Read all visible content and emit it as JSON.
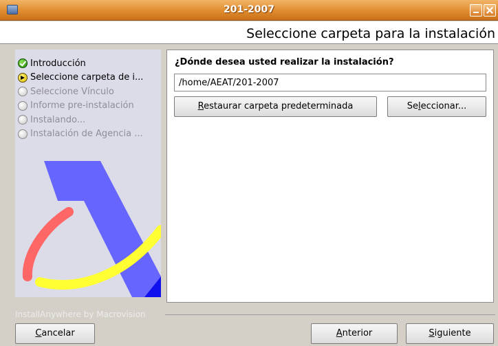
{
  "window": {
    "title": "201-2007"
  },
  "header": {
    "heading": "Seleccione carpeta para la instalación"
  },
  "steps": [
    {
      "label": "Introducción",
      "state": "done"
    },
    {
      "label": "Seleccione carpeta de i...",
      "state": "current"
    },
    {
      "label": "Seleccione  Vínculo",
      "state": "pending"
    },
    {
      "label": "Informe pre-instalación",
      "state": "pending"
    },
    {
      "label": "Instalando...",
      "state": "pending"
    },
    {
      "label": "Instalación de Agencia ...",
      "state": "pending"
    }
  ],
  "main": {
    "question": "¿Dónde desea usted realizar la instalación?",
    "path_value": "/home/AEAT/201-2007",
    "restore_button": {
      "mnemonic": "R",
      "rest": "estaurar carpeta predeterminada"
    },
    "choose_button": {
      "pre": "Se",
      "mnemonic": "l",
      "rest": "eccionar..."
    }
  },
  "footer": {
    "brand": "InstallAnywhere by Macrovision",
    "cancel_button": {
      "mnemonic": "C",
      "rest": "ancelar"
    },
    "back_button": {
      "mnemonic": "A",
      "rest": "nterior"
    },
    "next_button": {
      "mnemonic": "S",
      "rest": "iguiente"
    }
  },
  "colors": {
    "titlebar": "#e08c2e",
    "sidebar": "#dcdbe8",
    "logo_blue": "#6666ff",
    "logo_yellow": "#ffff33",
    "logo_red": "#ff6666"
  }
}
